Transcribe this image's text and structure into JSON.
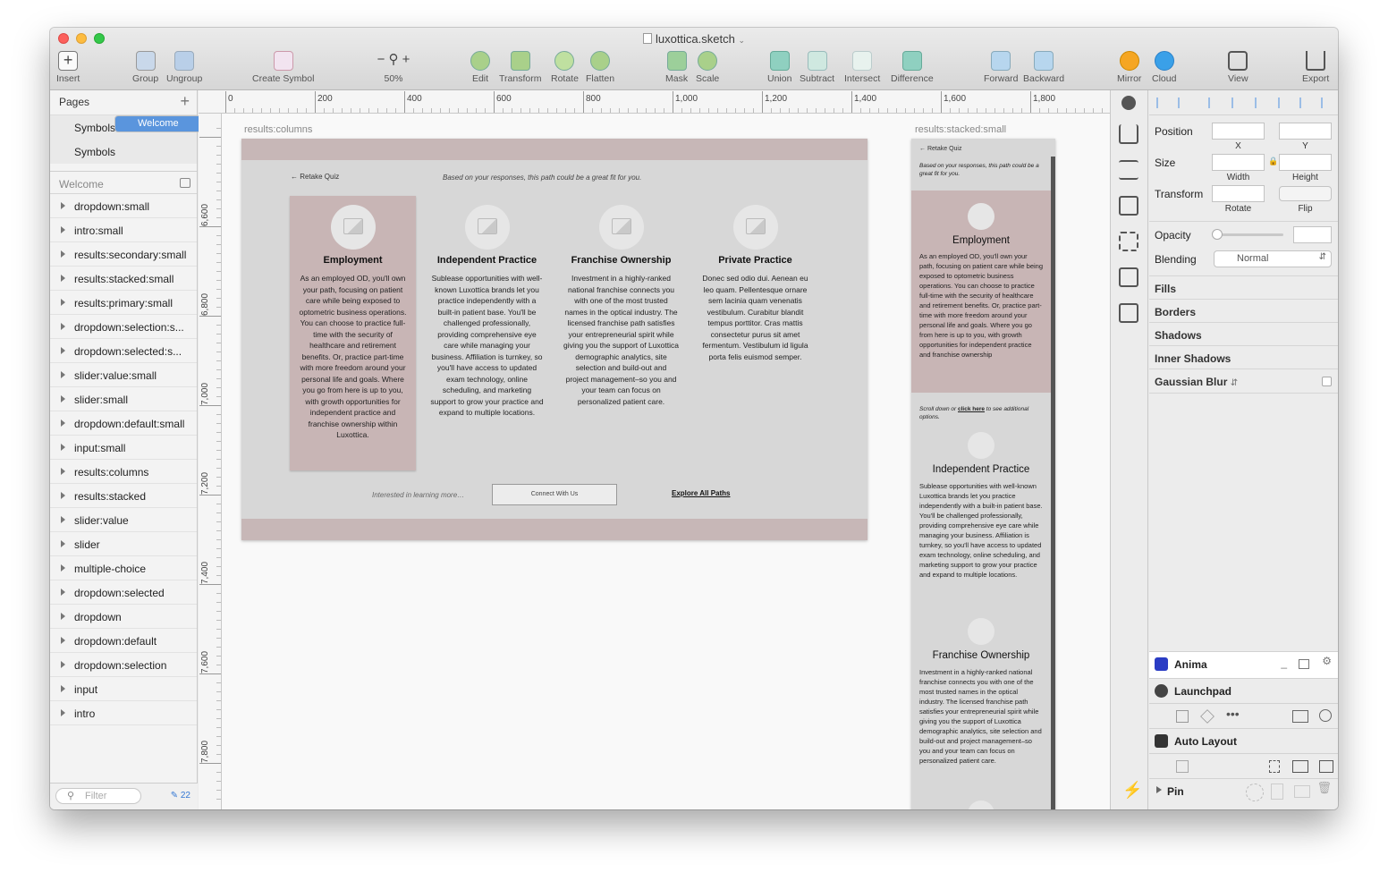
{
  "window": {
    "title": "luxottica.sketch"
  },
  "toolbar": [
    {
      "label": "Insert"
    },
    {
      "label": "Group"
    },
    {
      "label": "Ungroup"
    },
    {
      "label": "Create Symbol"
    },
    {
      "label": "50%"
    },
    {
      "label": "Edit"
    },
    {
      "label": "Transform"
    },
    {
      "label": "Rotate"
    },
    {
      "label": "Flatten"
    },
    {
      "label": "Mask"
    },
    {
      "label": "Scale"
    },
    {
      "label": "Union"
    },
    {
      "label": "Subtract"
    },
    {
      "label": "Intersect"
    },
    {
      "label": "Difference"
    },
    {
      "label": "Forward"
    },
    {
      "label": "Backward"
    },
    {
      "label": "Mirror"
    },
    {
      "label": "Cloud"
    },
    {
      "label": "View"
    },
    {
      "label": "Export"
    }
  ],
  "zoom": {
    "minus": "−",
    "plus": "+"
  },
  "pages": {
    "header": "Pages",
    "items": [
      "Welcome",
      "Symbols",
      "Symbols"
    ],
    "selected": "Welcome"
  },
  "layers": {
    "header": "Welcome",
    "items": [
      "dropdown:small",
      "intro:small",
      "results:secondary:small",
      "results:stacked:small",
      "results:primary:small",
      "dropdown:selection:s...",
      "dropdown:selected:s...",
      "slider:value:small",
      "slider:small",
      "dropdown:default:small",
      "input:small",
      "results:columns",
      "results:stacked",
      "slider:value",
      "slider",
      "multiple-choice",
      "dropdown:selected",
      "dropdown",
      "dropdown:default",
      "dropdown:selection",
      "input",
      "intro"
    ]
  },
  "filter": {
    "placeholder": "Filter",
    "count": "22"
  },
  "ruler_h": [
    "0",
    "200",
    "400",
    "600",
    "800",
    "1,000",
    "1,200",
    "1,400",
    "1,600",
    "1,800"
  ],
  "ruler_v": [
    "6,600",
    "6,800",
    "7,000",
    "7,200",
    "7,400",
    "7,600",
    "7,800"
  ],
  "artboard_columns": {
    "name": "results:columns",
    "retake": "← Retake Quiz",
    "based": "Based on your responses, this path could be a great fit for you.",
    "cards": [
      {
        "title": "Employment",
        "body": "As an employed OD, you'll own your path, focusing on patient care while being exposed to optometric business operations. You can choose to practice full-time with the security of healthcare and retirement benefits. Or, practice part-time with more freedom around your personal life and goals. Where you go from here is up to you, with growth opportunities for independent practice and franchise ownership within Luxottica."
      },
      {
        "title": "Independent Practice",
        "body": "Sublease opportunities with well-known Luxottica brands let you practice independently with a built-in patient base. You'll be challenged professionally, providing comprehensive eye care while managing your business. Affiliation is turnkey, so you'll have access to updated exam technology, online scheduling, and marketing support to grow your practice and expand to multiple locations."
      },
      {
        "title": "Franchise Ownership",
        "body": "Investment in a highly-ranked national franchise connects you with one of the most trusted names in the optical industry. The licensed franchise path satisfies your entrepreneurial spirit while giving you the support of Luxottica demographic analytics, site selection and build-out and project management–so you and your team can focus on personalized patient care."
      },
      {
        "title": "Private Practice",
        "body": "Donec sed odio dui. Aenean eu leo quam. Pellentesque ornare sem lacinia quam venenatis vestibulum. Curabitur blandit tempus porttitor. Cras mattis consectetur purus sit amet fermentum. Vestibulum id ligula porta felis euismod semper."
      }
    ],
    "interested": "Interested in learning more…",
    "connect": "Connect With Us",
    "explore": "Explore All Paths"
  },
  "artboard_stacked": {
    "name": "results:stacked:small",
    "retake": "← Retake Quiz",
    "based": "Based on your responses, this path could be a great fit for you.",
    "emp_title": "Employment",
    "emp_body": "As an employed OD, you'll own your path, focusing on patient care while being exposed to optometric business operations. You can choose to practice full-time with the security of healthcare and retirement benefits. Or, practice part-time with more freedom around your personal life and goals. Where you go from here is up to you, with growth opportunities for independent practice and franchise ownership",
    "scroll_pre": "Scroll down or ",
    "scroll_link": "click here",
    "scroll_post": " to see additional options.",
    "ind_title": "Independent Practice",
    "ind_body": "Sublease opportunities with well-known Luxottica brands let you practice independently with a built-in patient base. You'll be challenged professionally, providing comprehensive eye care while managing your business. Affiliation is turnkey, so you'll have access to updated exam technology, online scheduling, and marketing support to grow your practice and expand to multiple locations.",
    "fr_title": "Franchise Ownership",
    "fr_body": "Investment in a highly-ranked national franchise connects you with one of the most trusted names in the optical industry. The licensed franchise path satisfies your entrepreneurial spirit while giving you the support of Luxottica demographic analytics, site selection and build-out and project management–so you and your team can focus on personalized patient care."
  },
  "inspector": {
    "position": "Position",
    "x": "X",
    "y": "Y",
    "size": "Size",
    "width": "Width",
    "height": "Height",
    "transform": "Transform",
    "rotate": "Rotate",
    "flip": "Flip",
    "opacity": "Opacity",
    "blending": "Blending",
    "blending_value": "Normal",
    "fills": "Fills",
    "borders": "Borders",
    "shadows": "Shadows",
    "inner_shadows": "Inner Shadows",
    "gaussian_blur": "Gaussian Blur"
  },
  "plugins": {
    "anima": "Anima",
    "launchpad": "Launchpad",
    "auto_layout": "Auto Layout",
    "pin": "Pin"
  },
  "colors": {
    "selection": "#5a95dd",
    "card_highlight": "#c8b5b5",
    "band": "#c7b7b7",
    "anima": "#2a3cc4"
  }
}
